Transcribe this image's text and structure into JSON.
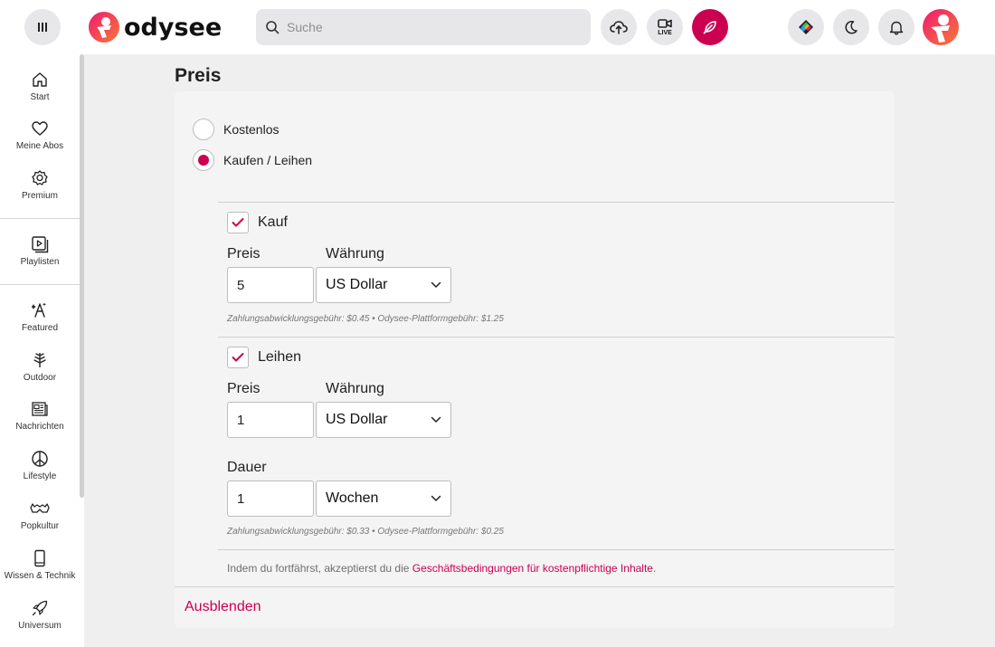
{
  "header": {
    "logo_text": "odysee",
    "search_placeholder": "Suche",
    "live_label": "LIVE"
  },
  "sidebar": {
    "items": [
      {
        "label": "Start",
        "icon": "home-icon"
      },
      {
        "label": "Meine Abos",
        "icon": "heart-icon"
      },
      {
        "label": "Premium",
        "icon": "premium-badge-icon"
      },
      {
        "label": "Playlisten",
        "icon": "playlist-icon"
      },
      {
        "label": "Featured",
        "icon": "featured-icon"
      },
      {
        "label": "Outdoor",
        "icon": "tree-icon"
      },
      {
        "label": "Nachrichten",
        "icon": "newspaper-icon"
      },
      {
        "label": "Lifestyle",
        "icon": "peace-icon"
      },
      {
        "label": "Popkultur",
        "icon": "mask-icon"
      },
      {
        "label": "Wissen & Technik",
        "icon": "phone-icon"
      },
      {
        "label": "Universum",
        "icon": "rocket-icon"
      }
    ]
  },
  "main": {
    "title": "Preis",
    "pricing_options": [
      {
        "label": "Kostenlos",
        "selected": false
      },
      {
        "label": "Kaufen / Leihen",
        "selected": true
      }
    ],
    "purchase": {
      "checkbox_label": "Kauf",
      "checked": true,
      "price_label": "Preis",
      "price_value": "5",
      "currency_label": "Währung",
      "currency_value": "US Dollar",
      "fee_text": "Zahlungsabwicklungsgebühr: $0.45 • Odysee-Plattformgebühr: $1.25"
    },
    "rental": {
      "checkbox_label": "Leihen",
      "checked": true,
      "price_label": "Preis",
      "price_value": "1",
      "currency_label": "Währung",
      "currency_value": "US Dollar",
      "duration_label": "Dauer",
      "duration_value": "1",
      "duration_unit": "Wochen",
      "fee_text": "Zahlungsabwicklungsgebühr: $0.33 • Odysee-Plattformgebühr: $0.25"
    },
    "terms_prefix": "Indem du fortfährst, akzeptierst du die ",
    "terms_link": "Geschäftsbedingungen für kostenpflichtige Inhalte",
    "terms_suffix": ".",
    "hide_label": "Ausblenden"
  },
  "colors": {
    "accent": "#cb0050",
    "background": "#f0eff0",
    "card": "#f5f4f5"
  }
}
